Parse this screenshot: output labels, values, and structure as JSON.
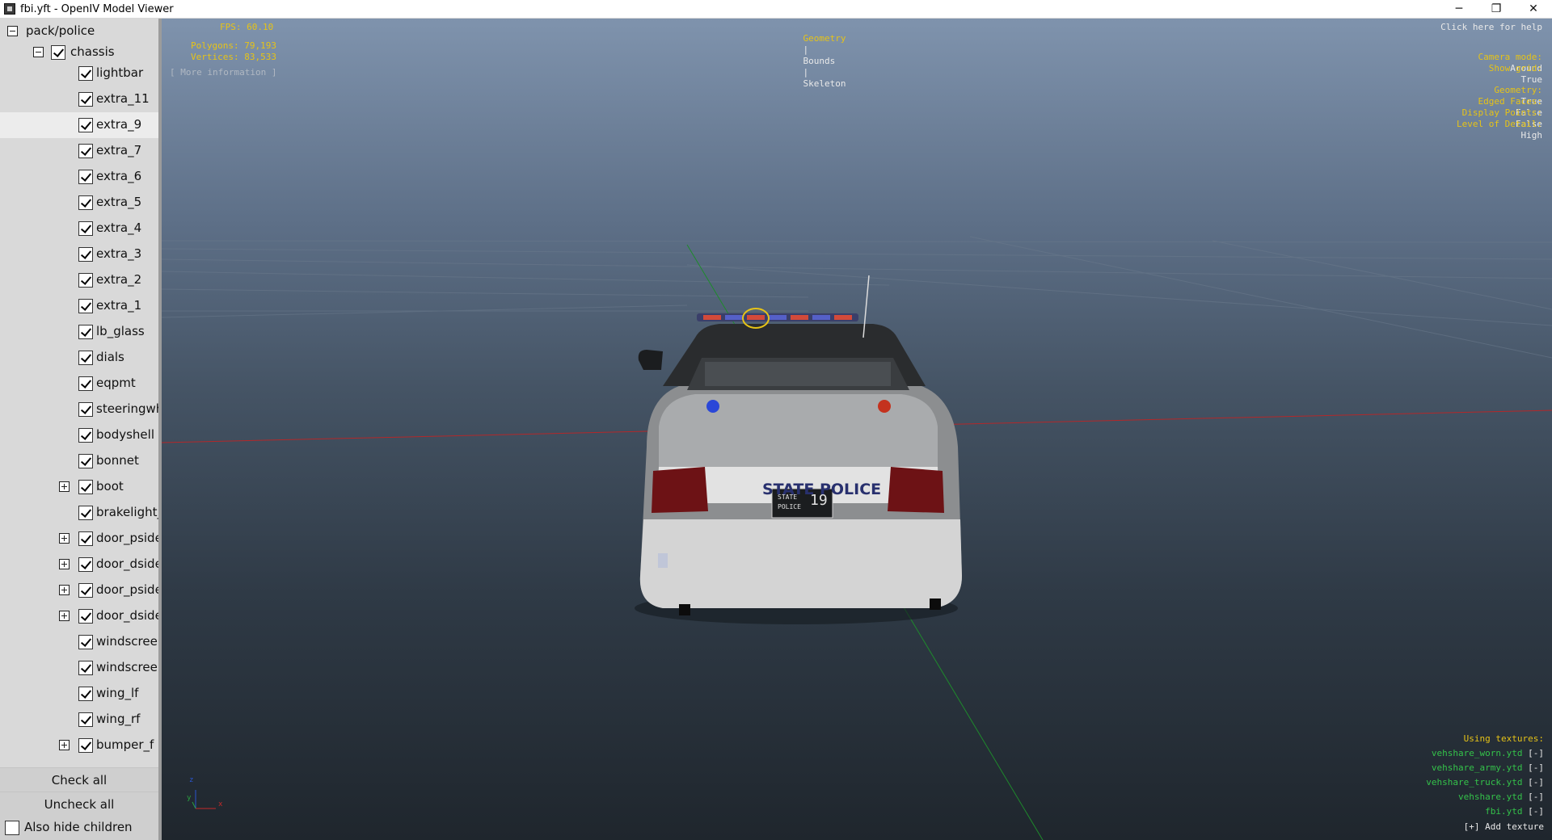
{
  "window": {
    "title": "fbi.yft - OpenIV Model Viewer",
    "controls": {
      "minimize": "─",
      "maximize": "❐",
      "close": "✕"
    }
  },
  "sidebar": {
    "root": {
      "label": "pack/police",
      "expanded": true
    },
    "chassis": {
      "label": "chassis",
      "checked": true,
      "expanded": true
    },
    "items": [
      {
        "label": "lightbar",
        "checked": true,
        "expander": ""
      },
      {
        "label": "extra_11",
        "checked": true,
        "expander": ""
      },
      {
        "label": "extra_9",
        "checked": true,
        "expander": "",
        "highlighted": true
      },
      {
        "label": "extra_7",
        "checked": true,
        "expander": ""
      },
      {
        "label": "extra_6",
        "checked": true,
        "expander": ""
      },
      {
        "label": "extra_5",
        "checked": true,
        "expander": ""
      },
      {
        "label": "extra_4",
        "checked": true,
        "expander": ""
      },
      {
        "label": "extra_3",
        "checked": true,
        "expander": ""
      },
      {
        "label": "extra_2",
        "checked": true,
        "expander": ""
      },
      {
        "label": "extra_1",
        "checked": true,
        "expander": ""
      },
      {
        "label": "lb_glass",
        "checked": true,
        "expander": ""
      },
      {
        "label": "dials",
        "checked": true,
        "expander": ""
      },
      {
        "label": "eqpmt",
        "checked": true,
        "expander": ""
      },
      {
        "label": "steeringwhe",
        "checked": true,
        "expander": ""
      },
      {
        "label": "bodyshell",
        "checked": true,
        "expander": ""
      },
      {
        "label": "bonnet",
        "checked": true,
        "expander": ""
      },
      {
        "label": "boot",
        "checked": true,
        "expander": "plus"
      },
      {
        "label": "brakelight_r",
        "checked": true,
        "expander": ""
      },
      {
        "label": "door_pside_",
        "checked": true,
        "expander": "plus"
      },
      {
        "label": "door_dside_",
        "checked": true,
        "expander": "plus"
      },
      {
        "label": "door_pside_",
        "checked": true,
        "expander": "plus"
      },
      {
        "label": "door_dside_",
        "checked": true,
        "expander": "plus"
      },
      {
        "label": "windscreen_",
        "checked": true,
        "expander": ""
      },
      {
        "label": "windscreen",
        "checked": true,
        "expander": ""
      },
      {
        "label": "wing_lf",
        "checked": true,
        "expander": ""
      },
      {
        "label": "wing_rf",
        "checked": true,
        "expander": ""
      },
      {
        "label": "bumper_f",
        "checked": true,
        "expander": "plus"
      }
    ],
    "check_all": "Check all",
    "uncheck_all": "Uncheck all",
    "also_hide_children": {
      "label": "Also hide children",
      "checked": false
    }
  },
  "viewport": {
    "fps": "FPS: 60.10",
    "polygons": "Polygons: 79,193",
    "vertices": "Vertices: 83,533",
    "more_info": "[ More information ]",
    "modes": {
      "geometry": "Geometry",
      "bounds": "Bounds",
      "skeleton": "Skeleton",
      "separator": "|"
    },
    "help": "Click here for help",
    "camera_mode": {
      "label": "Camera mode:",
      "value": "Around"
    },
    "show_grid": {
      "label": "Show grid:",
      "value": "True"
    },
    "geometry": {
      "label": "Geometry:",
      "value": "True"
    },
    "edged_faces": {
      "label": "Edged Faces:",
      "value": "False"
    },
    "display_points": {
      "label": "Display Points:",
      "value": "False"
    },
    "level_of_detail": {
      "label": "Level of Detail:",
      "value": "High"
    },
    "textures": {
      "heading": "Using textures:",
      "remove": "[-]",
      "items": [
        "vehshare_worn.ytd",
        "vehshare_army.ytd",
        "vehshare_truck.ytd",
        "vehshare.ytd",
        "fbi.ytd"
      ],
      "add": "[+] Add texture"
    },
    "car": {
      "trunk_text": "STATE POLICE",
      "plate_top": "STATE",
      "plate_sub": "POLICE",
      "plate_num": "19"
    },
    "axis": {
      "x": "x",
      "y": "y",
      "z": "z"
    },
    "colors": {
      "hud_yellow": "#e6c317",
      "hud_green": "#34c24a",
      "grid_red": "#b3282a",
      "grid_green": "#1e8a2c"
    }
  }
}
